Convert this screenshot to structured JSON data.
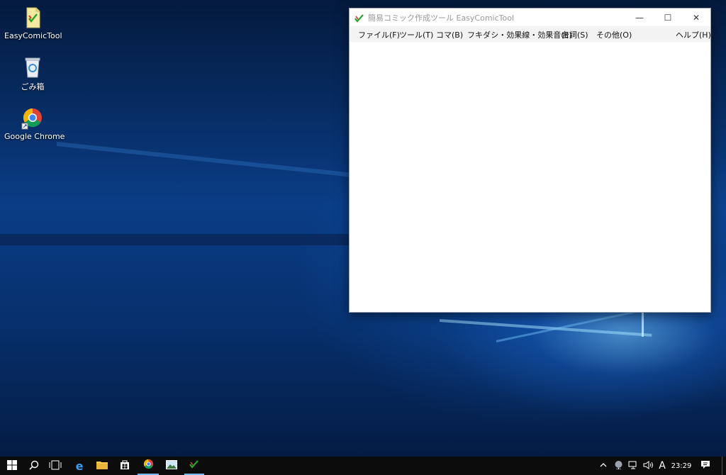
{
  "desktop": {
    "icons": [
      {
        "label": "EasyComicTool",
        "icon": "easycomictool-file-icon"
      },
      {
        "label": "ごみ箱",
        "icon": "recycle-bin-icon"
      },
      {
        "label": "Google Chrome",
        "icon": "chrome-icon"
      }
    ]
  },
  "window": {
    "title": "簡易コミック作成ツール EasyComicTool",
    "controls": {
      "minimize": "—",
      "maximize": "☐",
      "close": "✕"
    },
    "menu": [
      {
        "label": "ファイル(F)"
      },
      {
        "label": "ツール(T)"
      },
      {
        "label": "コマ(B)"
      },
      {
        "label": "フキダシ・効果線・効果音(E)"
      },
      {
        "label": "台詞(S)"
      },
      {
        "label": "その他(O)"
      },
      {
        "label": "ヘルプ(H)"
      }
    ]
  },
  "taskbar": {
    "clock": "23:29",
    "ime": "A",
    "colors": {
      "background": "#0c0c0c",
      "accent": "#76b9ed"
    }
  }
}
